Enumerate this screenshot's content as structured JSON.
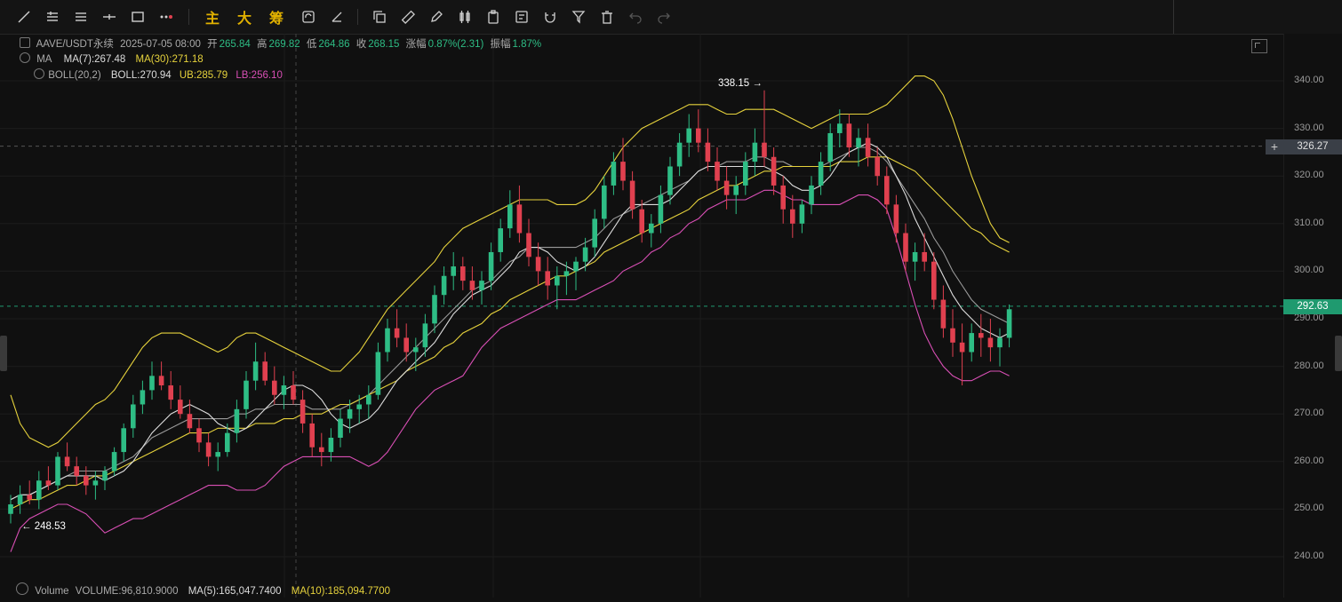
{
  "toolbar": {
    "modes": [
      "主",
      "大",
      "筹"
    ]
  },
  "header": {
    "symbol": "AAVE/USDT永续",
    "datetime": "2025-07-05 08:00",
    "open_label": "开",
    "open": "265.84",
    "high_label": "高",
    "high": "269.82",
    "low_label": "低",
    "low": "264.86",
    "close_label": "收",
    "close": "268.15",
    "change_label": "涨幅",
    "change": "0.87%(2.31)",
    "amp_label": "振幅",
    "amp": "1.87%"
  },
  "ma": {
    "label": "MA",
    "ma7": "MA(7):267.48",
    "ma30": "MA(30):271.18"
  },
  "boll": {
    "label": "BOLL(20,2)",
    "mid": "BOLL:270.94",
    "ub": "UB:285.79",
    "lb": "LB:256.10"
  },
  "volume": {
    "label": "Volume",
    "value": "VOLUME:96,810.9000",
    "ma5": "MA(5):165,047.7400",
    "ma10": "MA(10):185,094.7700"
  },
  "annotations": {
    "high_mark": "338.15",
    "low_mark": "248.53"
  },
  "price_axis": {
    "ticks": [
      "340.00",
      "330.00",
      "320.00",
      "310.00",
      "300.00",
      "290.00",
      "280.00",
      "270.00",
      "260.00",
      "250.00",
      "240.00"
    ],
    "crosshair_price": "326.27",
    "last_price": "292.63"
  },
  "colors": {
    "up": "#2ebd85",
    "down": "#e0404f",
    "ma7": "#dcdcdc",
    "ma30": "#e6d23c",
    "boll_ub": "#e6d23c",
    "boll_mid": "#dcdcdc",
    "boll_lb": "#d94fb5",
    "last_price": "#1f9a6f",
    "crosshair": "#3a3f47"
  },
  "chart_data": {
    "type": "candlestick",
    "symbol": "AAVE/USDT",
    "ylim": [
      236,
      345
    ],
    "candles": [
      [
        249,
        253,
        247,
        251
      ],
      [
        251,
        255,
        249,
        253
      ],
      [
        253,
        256,
        251,
        252
      ],
      [
        252,
        258,
        250,
        256
      ],
      [
        256,
        259,
        254,
        255
      ],
      [
        255,
        262,
        254,
        261
      ],
      [
        261,
        264,
        258,
        259
      ],
      [
        259,
        261,
        255,
        257
      ],
      [
        257,
        259,
        253,
        255
      ],
      [
        255,
        258,
        252,
        256
      ],
      [
        256,
        259,
        254,
        258
      ],
      [
        258,
        263,
        257,
        262
      ],
      [
        262,
        268,
        260,
        267
      ],
      [
        267,
        274,
        265,
        272
      ],
      [
        272,
        277,
        270,
        275
      ],
      [
        275,
        281,
        273,
        278
      ],
      [
        278,
        281,
        275,
        276
      ],
      [
        276,
        279,
        271,
        273
      ],
      [
        273,
        276,
        269,
        270
      ],
      [
        270,
        273,
        266,
        267
      ],
      [
        267,
        269,
        262,
        264
      ],
      [
        264,
        266,
        259,
        261
      ],
      [
        261,
        264,
        258,
        262
      ],
      [
        262,
        268,
        261,
        266
      ],
      [
        266,
        273,
        264,
        271
      ],
      [
        271,
        279,
        269,
        277
      ],
      [
        277,
        285,
        275,
        281
      ],
      [
        281,
        283,
        276,
        277
      ],
      [
        277,
        280,
        272,
        274
      ],
      [
        274,
        278,
        271,
        276
      ],
      [
        276,
        279,
        272,
        273
      ],
      [
        273,
        275,
        266,
        268
      ],
      [
        268,
        270,
        261,
        263
      ],
      [
        263,
        266,
        259,
        262
      ],
      [
        262,
        267,
        260,
        265
      ],
      [
        265,
        271,
        263,
        269
      ],
      [
        269,
        273,
        266,
        271
      ],
      [
        271,
        274,
        268,
        272
      ],
      [
        272,
        276,
        269,
        274
      ],
      [
        274,
        285,
        273,
        283
      ],
      [
        283,
        290,
        281,
        288
      ],
      [
        288,
        292,
        284,
        286
      ],
      [
        286,
        289,
        281,
        283
      ],
      [
        283,
        286,
        279,
        284
      ],
      [
        284,
        291,
        282,
        289
      ],
      [
        289,
        297,
        287,
        295
      ],
      [
        295,
        301,
        293,
        299
      ],
      [
        299,
        304,
        296,
        301
      ],
      [
        301,
        303,
        296,
        298
      ],
      [
        298,
        301,
        294,
        296
      ],
      [
        296,
        300,
        293,
        298
      ],
      [
        298,
        306,
        296,
        304
      ],
      [
        304,
        311,
        302,
        309
      ],
      [
        309,
        317,
        307,
        314
      ],
      [
        314,
        318,
        306,
        308
      ],
      [
        308,
        311,
        301,
        303
      ],
      [
        303,
        306,
        297,
        300
      ],
      [
        300,
        303,
        294,
        297
      ],
      [
        297,
        301,
        292,
        299
      ],
      [
        299,
        302,
        295,
        300
      ],
      [
        300,
        303,
        296,
        302
      ],
      [
        302,
        307,
        300,
        305
      ],
      [
        305,
        313,
        303,
        311
      ],
      [
        311,
        320,
        309,
        318
      ],
      [
        318,
        325,
        316,
        323
      ],
      [
        323,
        328,
        317,
        319
      ],
      [
        319,
        321,
        311,
        313
      ],
      [
        313,
        315,
        306,
        308
      ],
      [
        308,
        312,
        305,
        310
      ],
      [
        310,
        318,
        308,
        316
      ],
      [
        316,
        324,
        314,
        322
      ],
      [
        322,
        329,
        320,
        327
      ],
      [
        327,
        333,
        324,
        330
      ],
      [
        330,
        334,
        325,
        327
      ],
      [
        327,
        330,
        321,
        323
      ],
      [
        323,
        326,
        317,
        319
      ],
      [
        319,
        322,
        313,
        316
      ],
      [
        316,
        320,
        312,
        318
      ],
      [
        318,
        325,
        316,
        323
      ],
      [
        323,
        330,
        320,
        327
      ],
      [
        327,
        338,
        322,
        324
      ],
      [
        324,
        326,
        316,
        318
      ],
      [
        318,
        320,
        310,
        313
      ],
      [
        313,
        316,
        307,
        310
      ],
      [
        310,
        315,
        308,
        314
      ],
      [
        314,
        320,
        312,
        318
      ],
      [
        318,
        325,
        316,
        323
      ],
      [
        323,
        331,
        321,
        329
      ],
      [
        329,
        334,
        326,
        331
      ],
      [
        331,
        333,
        324,
        326
      ],
      [
        326,
        330,
        322,
        328
      ],
      [
        328,
        331,
        322,
        324
      ],
      [
        324,
        326,
        318,
        320
      ],
      [
        320,
        322,
        312,
        314
      ],
      [
        314,
        316,
        306,
        308
      ],
      [
        308,
        310,
        300,
        302
      ],
      [
        302,
        306,
        298,
        304
      ],
      [
        304,
        308,
        300,
        302
      ],
      [
        302,
        304,
        292,
        294
      ],
      [
        294,
        297,
        286,
        288
      ],
      [
        288,
        292,
        282,
        285
      ],
      [
        285,
        289,
        276,
        283
      ],
      [
        283,
        289,
        281,
        287
      ],
      [
        287,
        291,
        282,
        286
      ],
      [
        286,
        290,
        281,
        284
      ],
      [
        284,
        288,
        280,
        286
      ],
      [
        286,
        293,
        284,
        292
      ]
    ],
    "ma7": [
      252,
      253,
      253,
      254,
      255,
      256,
      257,
      257,
      257,
      257,
      256,
      257,
      258,
      260,
      263,
      266,
      268,
      270,
      271,
      272,
      271,
      270,
      268,
      267,
      266,
      267,
      269,
      271,
      273,
      275,
      276,
      276,
      275,
      273,
      270,
      268,
      267,
      268,
      269,
      271,
      274,
      277,
      279,
      281,
      283,
      285,
      288,
      291,
      293,
      295,
      296,
      297,
      299,
      301,
      304,
      305,
      305,
      304,
      302,
      301,
      300,
      301,
      303,
      306,
      309,
      312,
      314,
      314,
      314,
      314,
      315,
      317,
      319,
      321,
      322,
      322,
      322,
      322,
      322,
      322,
      322,
      321,
      320,
      318,
      317,
      317,
      318,
      320,
      323,
      325,
      326,
      327,
      326,
      324,
      320,
      316,
      311,
      307,
      303,
      299,
      295,
      292,
      290,
      288,
      287,
      286,
      287
    ],
    "ma30": [
      250,
      251,
      252,
      252,
      253,
      254,
      255,
      255,
      256,
      257,
      257,
      258,
      259,
      260,
      261,
      262,
      263,
      264,
      265,
      266,
      266,
      266,
      267,
      267,
      267,
      267,
      268,
      268,
      268,
      269,
      269,
      270,
      270,
      270,
      271,
      272,
      272,
      273,
      274,
      275,
      276,
      277,
      279,
      280,
      281,
      282,
      284,
      285,
      287,
      288,
      289,
      291,
      292,
      294,
      295,
      296,
      297,
      298,
      299,
      299,
      300,
      301,
      302,
      304,
      305,
      306,
      307,
      308,
      309,
      310,
      311,
      312,
      313,
      315,
      316,
      317,
      318,
      318,
      319,
      320,
      321,
      321,
      322,
      322,
      322,
      322,
      322,
      322,
      323,
      323,
      323,
      324,
      324,
      324,
      323,
      322,
      321,
      319,
      317,
      315,
      313,
      311,
      309,
      308,
      306,
      305,
      304
    ],
    "boll_ub": [
      274,
      268,
      265,
      264,
      263,
      264,
      266,
      268,
      270,
      272,
      273,
      275,
      278,
      281,
      284,
      286,
      287,
      287,
      287,
      286,
      285,
      284,
      283,
      284,
      286,
      287,
      287,
      286,
      285,
      284,
      283,
      282,
      281,
      280,
      279,
      279,
      281,
      283,
      286,
      289,
      292,
      294,
      296,
      298,
      300,
      302,
      305,
      307,
      309,
      310,
      311,
      312,
      313,
      314,
      315,
      315,
      315,
      315,
      314,
      314,
      314,
      315,
      317,
      320,
      323,
      326,
      328,
      330,
      331,
      332,
      333,
      334,
      335,
      335,
      335,
      334,
      333,
      333,
      334,
      334,
      334,
      334,
      333,
      332,
      331,
      330,
      331,
      332,
      333,
      333,
      333,
      333,
      334,
      335,
      337,
      339,
      341,
      341,
      340,
      337,
      332,
      326,
      320,
      315,
      310,
      307,
      306
    ],
    "boll_mid": [
      252,
      253,
      253,
      254,
      255,
      256,
      257,
      258,
      258,
      258,
      258,
      259,
      260,
      261,
      263,
      265,
      266,
      267,
      268,
      269,
      269,
      269,
      269,
      269,
      270,
      270,
      271,
      271,
      272,
      272,
      272,
      272,
      271,
      271,
      271,
      271,
      272,
      273,
      274,
      276,
      278,
      280,
      282,
      284,
      286,
      288,
      290,
      292,
      294,
      296,
      297,
      298,
      300,
      302,
      303,
      305,
      305,
      305,
      305,
      305,
      305,
      306,
      307,
      309,
      311,
      312,
      313,
      314,
      315,
      316,
      317,
      318,
      319,
      321,
      322,
      322,
      323,
      323,
      323,
      324,
      324,
      323,
      323,
      322,
      322,
      322,
      322,
      323,
      324,
      325,
      326,
      326,
      325,
      323,
      320,
      317,
      314,
      311,
      307,
      304,
      300,
      297,
      294,
      292,
      291,
      290,
      289
    ],
    "boll_lb": [
      241,
      246,
      248,
      249,
      250,
      251,
      251,
      250,
      249,
      247,
      245,
      246,
      247,
      248,
      248,
      249,
      250,
      251,
      252,
      253,
      254,
      255,
      255,
      255,
      254,
      254,
      254,
      255,
      257,
      259,
      260,
      261,
      261,
      261,
      261,
      261,
      261,
      260,
      259,
      260,
      262,
      265,
      268,
      271,
      273,
      275,
      276,
      277,
      278,
      281,
      284,
      286,
      288,
      289,
      290,
      291,
      292,
      293,
      294,
      294,
      294,
      295,
      296,
      297,
      298,
      300,
      301,
      302,
      304,
      305,
      307,
      308,
      310,
      311,
      313,
      314,
      315,
      315,
      315,
      316,
      317,
      317,
      316,
      315,
      315,
      314,
      314,
      314,
      314,
      315,
      316,
      316,
      315,
      313,
      307,
      300,
      293,
      287,
      283,
      280,
      278,
      277,
      277,
      278,
      279,
      279,
      278
    ]
  }
}
